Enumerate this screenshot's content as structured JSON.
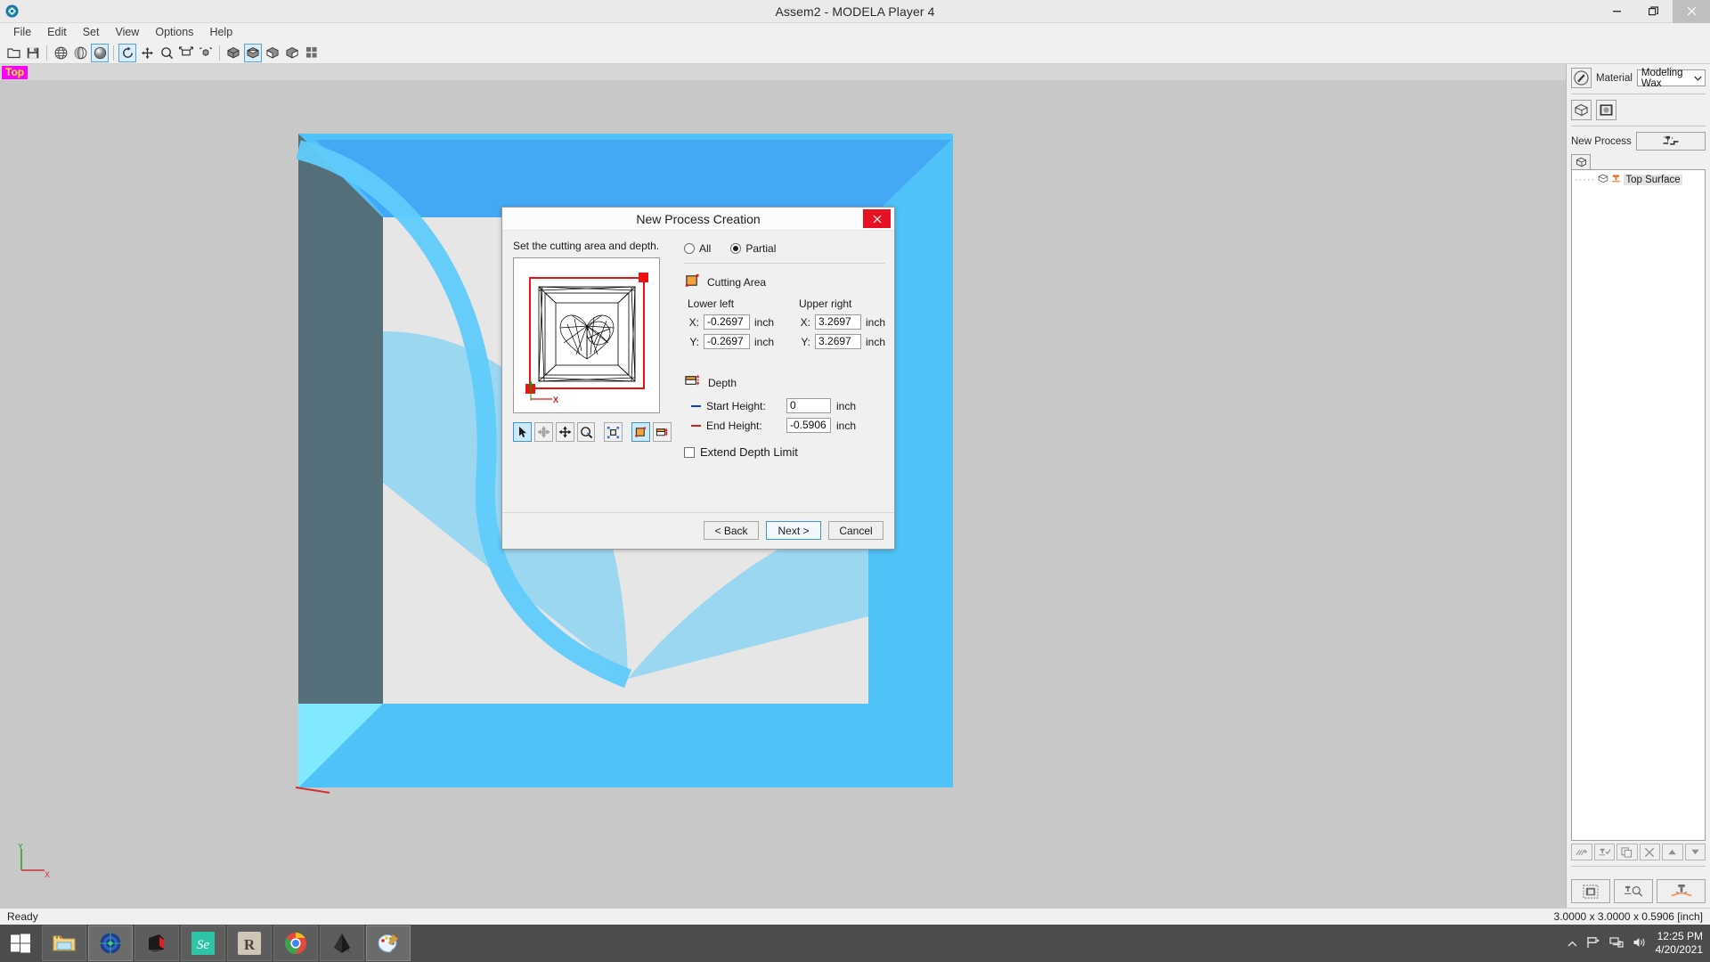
{
  "window": {
    "title": "Assem2 - MODELA Player 4",
    "app_icon": "modela-app-icon",
    "minimize": "–",
    "maximize": "❐",
    "close": "✕"
  },
  "menu": {
    "items": [
      {
        "label": "File"
      },
      {
        "label": "Edit"
      },
      {
        "label": "Set"
      },
      {
        "label": "View"
      },
      {
        "label": "Options"
      },
      {
        "label": "Help"
      }
    ]
  },
  "toolbar": {
    "buttons": [
      {
        "name": "open-file-icon",
        "group": 0
      },
      {
        "name": "save-file-icon",
        "group": 0
      },
      {
        "name": "globe-view-icon",
        "group": 1
      },
      {
        "name": "half-sphere-view-icon",
        "group": 1
      },
      {
        "name": "shaded-sphere-view-icon",
        "group": 1,
        "active": true
      },
      {
        "name": "rotate-view-icon",
        "group": 2,
        "active": true
      },
      {
        "name": "pan-view-icon",
        "group": 2
      },
      {
        "name": "zoom-view-icon",
        "group": 2
      },
      {
        "name": "fit-view-icon",
        "group": 2
      },
      {
        "name": "zoom-object-icon",
        "group": 2
      },
      {
        "name": "box-top-view-icon",
        "group": 3
      },
      {
        "name": "box-open-top-view-icon",
        "group": 3,
        "active": true
      },
      {
        "name": "box-front-view-icon",
        "group": 3
      },
      {
        "name": "box-side-view-icon",
        "group": 3
      },
      {
        "name": "grid-view-icon",
        "group": 3
      }
    ]
  },
  "viewport": {
    "view_label": "Top",
    "axis_x_label": "X",
    "axis_y_label": "Y",
    "colors": {
      "background": "#c8c8c8",
      "frame_top": "#4fc3f7",
      "frame_bevel": "#42a5f5",
      "frame_side_dark": "#546e7a",
      "frame_highlight": "#80e9ff",
      "inner_plate": "#e6e6e6"
    }
  },
  "sidebar": {
    "material_label": "Material",
    "material_value": "Modeling Wax",
    "material_icon": "material-palette-icon",
    "dropdown_icon": "chevron-down-icon",
    "view_buttons": [
      {
        "name": "model-wireframe-icon"
      },
      {
        "name": "model-preview-icon"
      }
    ],
    "new_process_label": "New Process",
    "new_process_icon": "cutting-tool-path-icon",
    "tree_tab_icon": "model-tree-icon",
    "tree": [
      {
        "label": "Top Surface",
        "icon": "surface-icon",
        "tool_icon": "tool-orange-icon",
        "selected": true
      }
    ],
    "tree_tools": [
      {
        "name": "preview-cut-icon"
      },
      {
        "name": "check-tool-icon"
      },
      {
        "name": "copy-icon"
      },
      {
        "name": "delete-icon"
      },
      {
        "name": "move-up-icon"
      },
      {
        "name": "move-down-icon"
      }
    ],
    "bottom_tools": [
      {
        "name": "layout-icon"
      },
      {
        "name": "tool-search-icon"
      },
      {
        "name": "cut-simulation-icon"
      }
    ]
  },
  "statusbar": {
    "status": "Ready",
    "dimensions": "3.0000 x 3.0000 x 0.5906 [inch]"
  },
  "taskbar": {
    "start_icon": "windows-start-icon",
    "items": [
      {
        "name": "file-explorer-icon",
        "state": "open"
      },
      {
        "name": "modela-player-icon",
        "state": "active"
      },
      {
        "name": "roland-icon",
        "state": "open"
      },
      {
        "name": "selenium-icon",
        "state": "open"
      },
      {
        "name": "rhino-icon",
        "state": "open"
      },
      {
        "name": "chrome-icon",
        "state": "open"
      },
      {
        "name": "inkscape-icon",
        "state": "open"
      },
      {
        "name": "paint-icon",
        "state": "active"
      }
    ],
    "tray": [
      {
        "name": "show-hidden-icons-icon"
      },
      {
        "name": "flag-action-center-icon"
      },
      {
        "name": "network-icon"
      },
      {
        "name": "volume-icon"
      }
    ],
    "clock_time": "12:25 PM",
    "clock_date": "4/20/2021"
  },
  "dialog": {
    "title": "New Process Creation",
    "close_label": "✕",
    "hint": "Set the cutting area and depth.",
    "scope": {
      "all_label": "All",
      "partial_label": "Partial",
      "selected": "Partial"
    },
    "preview_tools": [
      {
        "name": "select-arrow-tool-icon",
        "selected": true
      },
      {
        "name": "rotate-tool-icon",
        "disabled": true
      },
      {
        "name": "move-tool-icon"
      },
      {
        "name": "zoom-tool-icon"
      },
      {
        "name": "fit-tool-icon"
      },
      {
        "name": "cutting-area-tool-icon",
        "selected": true
      },
      {
        "name": "depth-tool-icon"
      }
    ],
    "cutting_area": {
      "icon": "cutting-area-icon",
      "title": "Cutting Area",
      "lower_left_label": "Lower left",
      "upper_right_label": "Upper right",
      "ll_x_label": "X:",
      "ll_x_value": "-0.2697",
      "ll_x_unit": "inch",
      "ll_y_label": "Y:",
      "ll_y_value": "-0.2697",
      "ll_y_unit": "inch",
      "ur_x_label": "X:",
      "ur_x_value": "3.2697",
      "ur_x_unit": "inch",
      "ur_y_label": "Y:",
      "ur_y_value": "3.2697",
      "ur_y_unit": "inch"
    },
    "depth": {
      "icon": "depth-icon",
      "title": "Depth",
      "start_label": "Start Height:",
      "start_value": "0",
      "start_unit": "inch",
      "start_color": "#0b3fd6",
      "end_label": "End Height:",
      "end_value": "-0.5906",
      "end_unit": "inch",
      "end_color": "#e02020",
      "extend_label": "Extend Depth Limit",
      "extend_checked": false
    },
    "buttons": {
      "back": "< Back",
      "next": "Next >",
      "cancel": "Cancel"
    }
  }
}
